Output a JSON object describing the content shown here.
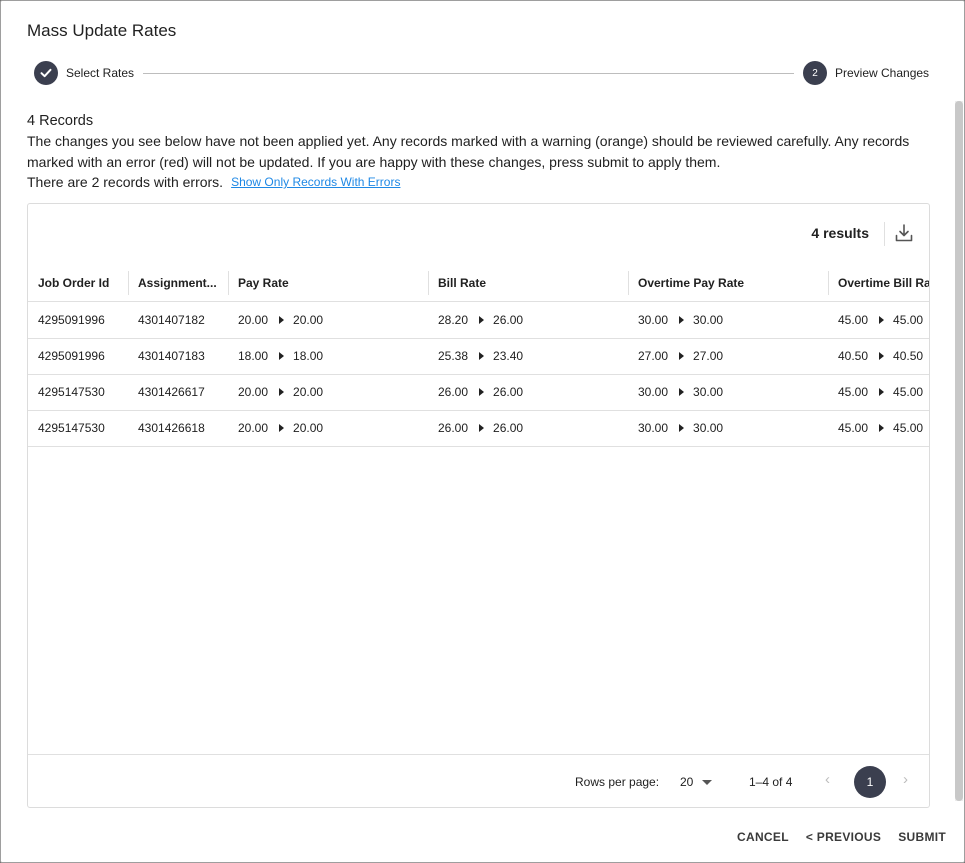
{
  "dialog": {
    "title": "Mass Update Rates"
  },
  "stepper": {
    "step1": {
      "label": "Select Rates"
    },
    "step2": {
      "number": "2",
      "label": "Preview Changes"
    }
  },
  "summary": {
    "records_count": "4 Records",
    "info_text": "The changes you see below have not been applied yet. Any records marked with a warning (orange) should be reviewed carefully. Any records marked with an error (red) will not be updated. If you are happy with these changes, press submit to apply them.",
    "errors_text": "There are 2 records with errors.",
    "errors_link": "Show Only Records With Errors"
  },
  "table": {
    "results": "4 results",
    "columns": [
      "Job Order Id",
      "Assignment...",
      "Pay Rate",
      "Bill Rate",
      "Overtime Pay Rate",
      "Overtime Bill Rate"
    ],
    "rows": [
      {
        "job_order_id": "4295091996",
        "assignment": "4301407182",
        "pay_old": "20.00",
        "pay_new": "20.00",
        "bill_old": "28.20",
        "bill_new": "26.00",
        "ot_pay_old": "30.00",
        "ot_pay_new": "30.00",
        "ot_bill_old": "45.00",
        "ot_bill_new": "45.00"
      },
      {
        "job_order_id": "4295091996",
        "assignment": "4301407183",
        "pay_old": "18.00",
        "pay_new": "18.00",
        "bill_old": "25.38",
        "bill_new": "23.40",
        "ot_pay_old": "27.00",
        "ot_pay_new": "27.00",
        "ot_bill_old": "40.50",
        "ot_bill_new": "40.50"
      },
      {
        "job_order_id": "4295147530",
        "assignment": "4301426617",
        "pay_old": "20.00",
        "pay_new": "20.00",
        "bill_old": "26.00",
        "bill_new": "26.00",
        "ot_pay_old": "30.00",
        "ot_pay_new": "30.00",
        "ot_bill_old": "45.00",
        "ot_bill_new": "45.00"
      },
      {
        "job_order_id": "4295147530",
        "assignment": "4301426618",
        "pay_old": "20.00",
        "pay_new": "20.00",
        "bill_old": "26.00",
        "bill_new": "26.00",
        "ot_pay_old": "30.00",
        "ot_pay_new": "30.00",
        "ot_bill_old": "45.00",
        "ot_bill_new": "45.00"
      }
    ]
  },
  "pagination": {
    "rows_per_page_label": "Rows per page:",
    "rows_per_page": "20",
    "range": "1–4 of 4",
    "current_page": "1"
  },
  "actions": {
    "cancel": "CANCEL",
    "previous": "< PREVIOUS",
    "submit": "SUBMIT"
  },
  "icons": {
    "step1": "check-icon",
    "download": "download-icon",
    "prev": "chevron-left-icon",
    "next": "chevron-right-icon",
    "caret": "caret-down-icon"
  },
  "colors": {
    "step_circle": "#3b3f4f",
    "link": "#1e88e5"
  }
}
